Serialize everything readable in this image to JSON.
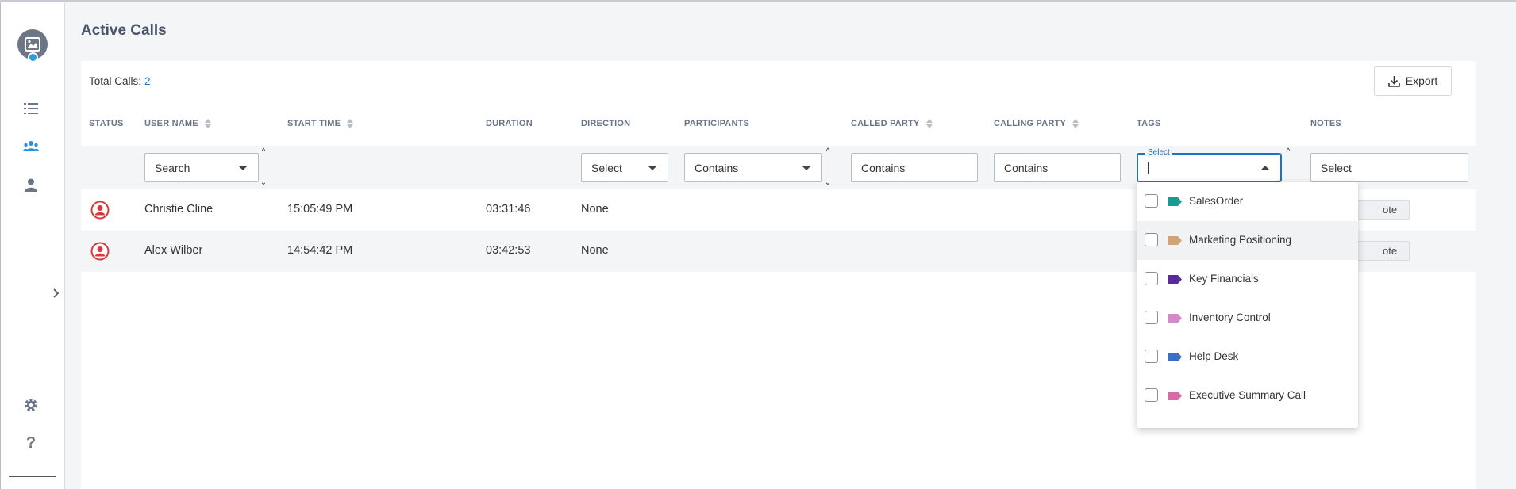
{
  "page": {
    "title": "Active Calls"
  },
  "summary": {
    "total_label": "Total Calls:",
    "total_value": "2"
  },
  "toolbar": {
    "export_label": "Export"
  },
  "columns": {
    "status": "STATUS",
    "user_name": "USER NAME",
    "start_time": "START TIME",
    "duration": "DURATION",
    "direction": "DIRECTION",
    "participants": "PARTICIPANTS",
    "called_party": "CALLED PARTY",
    "calling_party": "CALLING PARTY",
    "tags": "TAGS",
    "notes": "NOTES"
  },
  "filters": {
    "user_name": "Search",
    "direction": "Select",
    "participants": "Contains",
    "called_party": "Contains",
    "calling_party": "Contains",
    "tags_legend": "Select",
    "notes": "Select"
  },
  "rows": [
    {
      "user_name": "Christie Cline",
      "start_time": "15:05:49 PM",
      "duration": "03:31:46",
      "direction": "None",
      "note_label": "ote"
    },
    {
      "user_name": "Alex Wilber",
      "start_time": "14:54:42 PM",
      "duration": "03:42:53",
      "direction": "None",
      "note_label": "ote"
    }
  ],
  "tag_options": [
    {
      "label": "SalesOrder",
      "color": "#1a9b8f"
    },
    {
      "label": "Marketing Positioning",
      "color": "#d4a373"
    },
    {
      "label": "Key Financials",
      "color": "#5b2a9c"
    },
    {
      "label": "Inventory Control",
      "color": "#d487c9"
    },
    {
      "label": "Help Desk",
      "color": "#3a6fc4"
    },
    {
      "label": "Executive Summary Call",
      "color": "#d96aa7"
    }
  ],
  "colors": {
    "accent": "#1a73c8",
    "status_red": "#d9383a"
  },
  "icons": {
    "sidebar": [
      "image-avatar-icon",
      "list-icon",
      "users-icon",
      "user-icon",
      "chevron-right-icon",
      "gear-icon",
      "help-icon"
    ]
  }
}
